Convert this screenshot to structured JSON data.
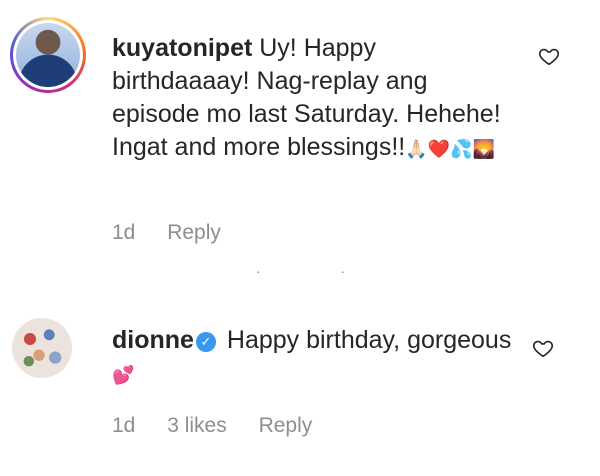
{
  "comments": [
    {
      "username": "kuyatonipet",
      "text": "Uy! Happy birthdaaaay! Nag-replay ang episode mo last Saturday. Hehehe! Ingat and more blessings!!",
      "emoji": "🙏🏻❤️💦🌄",
      "time": "1d",
      "reply_label": "Reply"
    },
    {
      "username": "dionne",
      "verified": true,
      "text": "Happy birthday, gorgeous",
      "emoji": "💕",
      "time": "1d",
      "likes": "3 likes",
      "reply_label": "Reply"
    }
  ],
  "separator": "· ·",
  "colors": {
    "text": "#262626",
    "meta": "#8e8e8e",
    "verified": "#3897f0",
    "heart_emoji": "#c0303a"
  },
  "icons": {
    "like": "heart-outline-icon",
    "verified": "verified-badge-icon"
  }
}
